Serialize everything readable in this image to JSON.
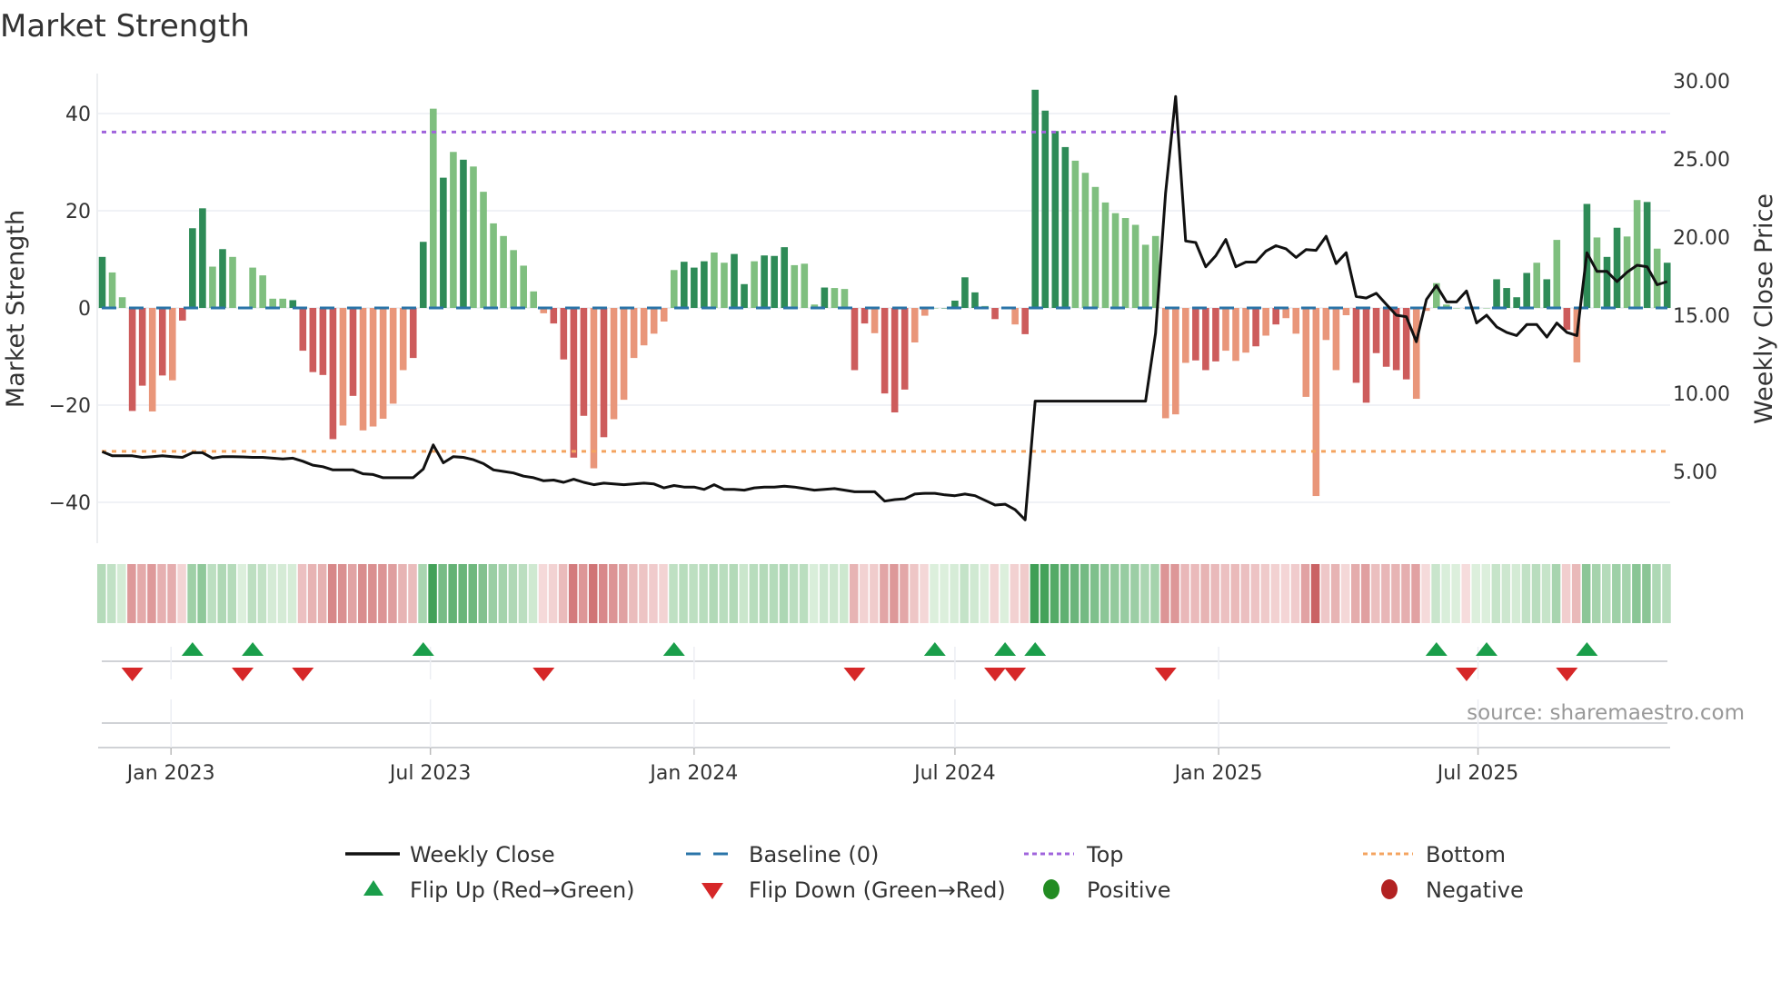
{
  "title": "Market Strength",
  "source": "source: sharemaestro.com",
  "colors": {
    "pos_strong": "#2e8b57",
    "pos_weak": "#7fbf7f",
    "neg_strong": "#cd5c5c",
    "neg_weak": "#e9967a",
    "baseline": "#2a74a8",
    "top": "#a064dc",
    "bottom": "#f4a460",
    "line": "#111111",
    "flip_up": "#1a9e4a",
    "flip_down": "#d62728",
    "positive": "#228b22",
    "negative": "#b22222"
  },
  "chart_data": {
    "type": "bar",
    "title": "Market Strength",
    "ylabel": "Market Strength",
    "y2label": "Weekly Close Price",
    "ylim": [
      -49,
      49
    ],
    "y2lim": [
      0.5,
      31.2
    ],
    "yticks": [
      "40",
      "20",
      "0",
      "−20",
      "−40"
    ],
    "ytick_values": [
      40,
      20,
      0,
      -20,
      -40
    ],
    "y2ticks": [
      "30.00",
      "25.00",
      "20.00",
      "15.00",
      "10.00",
      "5.00"
    ],
    "y2tick_values": [
      30,
      25,
      20,
      15,
      10,
      5
    ],
    "xticks": [
      {
        "label": "Jan 2023",
        "date": "2023-01-01"
      },
      {
        "label": "Jul 2023",
        "date": "2023-07-01"
      },
      {
        "label": "Jan 2024",
        "date": "2024-01-01"
      },
      {
        "label": "Jul 2024",
        "date": "2024-07-01"
      },
      {
        "label": "Jan 2025",
        "date": "2025-01-01"
      },
      {
        "label": "Jul 2025",
        "date": "2025-07-01"
      }
    ],
    "start_date": "2022-11-14",
    "interval": "weekly",
    "top_level": 36.2,
    "bottom_level": -29.5,
    "strength": [
      10.5,
      7.3,
      2.2,
      -21.2,
      -16,
      -21.3,
      -13.9,
      -14.9,
      -2.6,
      16.4,
      20.5,
      8.5,
      12.1,
      10.5,
      0,
      8.3,
      6.7,
      1.9,
      1.9,
      1.6,
      -8.8,
      -13.2,
      -13.8,
      -27,
      -24.2,
      -18.1,
      -25.2,
      -24.4,
      -22.8,
      -19.7,
      -12.8,
      -10.3,
      13.6,
      41,
      26.8,
      32.1,
      30.5,
      29.1,
      23.9,
      17.4,
      14.8,
      11.9,
      8.7,
      3.4,
      -1.1,
      -3.2,
      -10.6,
      -30.8,
      -22.2,
      -33,
      -26.6,
      -22.9,
      -18.9,
      -10.3,
      -7.7,
      -5.3,
      -2.8,
      7.8,
      9.5,
      8.3,
      9.6,
      11.4,
      9.3,
      11.1,
      4.9,
      9.6,
      10.8,
      10.7,
      12.5,
      8.8,
      9.1,
      0.7,
      4.2,
      4.1,
      3.9,
      -12.8,
      -3.2,
      -5.2,
      -17.6,
      -21.5,
      -16.8,
      -7.1,
      -1.6,
      0,
      0,
      1.5,
      6.3,
      3.2,
      0.4,
      -2.3,
      0,
      -3.4,
      -5.4,
      44.9,
      40.6,
      36.4,
      33.1,
      30.3,
      27.8,
      24.9,
      21.7,
      19.5,
      18.5,
      17.1,
      13,
      14.8,
      -22.7,
      -21.9,
      -11.3,
      -10.8,
      -12.8,
      -11,
      -8.8,
      -10.9,
      -9.2,
      -7.9,
      -5.7,
      -3.4,
      -2.1,
      -5.3,
      -18.3,
      -38.7,
      -6.6,
      -12.8,
      -1.5,
      -15.4,
      -19.5,
      -9.3,
      -12.1,
      -12.8,
      -14.7,
      -18.7,
      -0.6,
      5.1,
      0.7,
      0,
      -0.1,
      0,
      0,
      5.9,
      4.1,
      2.2,
      7.2,
      9.3,
      5.9,
      14,
      -4.5,
      -11.2,
      21.4,
      14.5,
      10.5,
      16.5,
      14.7,
      22.2,
      21.8,
      12.2,
      9.3
    ],
    "shade": "dllddldldddldldlllldddddldlllllddldldllllllllddddldllllllldddllddldddllldllddldddlllddddldlldddddlllllllllllldddllldldlllllllddddddllllllllddddldldldlddlldldddddlldldlddlldll",
    "weekly_close": [
      6.27,
      6.0,
      6.0,
      6.0,
      5.9,
      5.95,
      6.0,
      5.95,
      5.9,
      6.2,
      6.2,
      5.85,
      5.95,
      5.95,
      5.93,
      5.9,
      5.9,
      5.85,
      5.8,
      5.85,
      5.65,
      5.4,
      5.3,
      5.1,
      5.1,
      5.1,
      4.85,
      4.8,
      4.6,
      4.6,
      4.6,
      4.6,
      5.15,
      6.7,
      5.55,
      5.95,
      5.9,
      5.75,
      5.5,
      5.1,
      5.0,
      4.9,
      4.7,
      4.6,
      4.4,
      4.45,
      4.3,
      4.5,
      4.3,
      4.15,
      4.25,
      4.2,
      4.15,
      4.2,
      4.25,
      4.2,
      3.95,
      4.1,
      4.0,
      4.0,
      3.85,
      4.15,
      3.85,
      3.85,
      3.8,
      3.95,
      4.0,
      4.0,
      4.05,
      4.0,
      3.9,
      3.8,
      3.85,
      3.9,
      3.8,
      3.7,
      3.7,
      3.7,
      3.1,
      3.2,
      3.25,
      3.55,
      3.6,
      3.6,
      3.5,
      3.45,
      3.55,
      3.45,
      3.15,
      2.85,
      2.9,
      2.55,
      1.9,
      9.5,
      9.5,
      9.5,
      9.5,
      9.5,
      9.5,
      9.5,
      9.5,
      9.5,
      9.5,
      9.5,
      9.5,
      13.85,
      22.8,
      29.0,
      19.75,
      19.65,
      18.1,
      18.8,
      19.85,
      18.1,
      18.4,
      18.4,
      19.1,
      19.45,
      19.25,
      18.7,
      19.2,
      19.15,
      20.05,
      18.3,
      19.0,
      16.2,
      16.1,
      16.4,
      15.7,
      15.0,
      14.9,
      13.3,
      16.0,
      16.9,
      15.85,
      15.85,
      16.55,
      14.5,
      15.0,
      14.25,
      13.9,
      13.7,
      14.4,
      14.4,
      13.6,
      14.5,
      13.9,
      13.7,
      19.0,
      17.8,
      17.8,
      17.15,
      17.75,
      18.2,
      18.1,
      16.95,
      17.15
    ],
    "flip_up_weeks": [
      10,
      16,
      33,
      58,
      84,
      91,
      94,
      134,
      139,
      149
    ],
    "flip_down_weeks": [
      4,
      15,
      21,
      45,
      76,
      90,
      92,
      107,
      137,
      147
    ],
    "legend": {
      "weekly_close": "Weekly Close",
      "baseline": "Baseline (0)",
      "top": "Top",
      "bottom": "Bottom",
      "flip_up": "Flip Up (Red→Green)",
      "flip_down": "Flip Down (Green→Red)",
      "positive": "Positive",
      "negative": "Negative"
    },
    "legend_position": "bottom-center"
  }
}
